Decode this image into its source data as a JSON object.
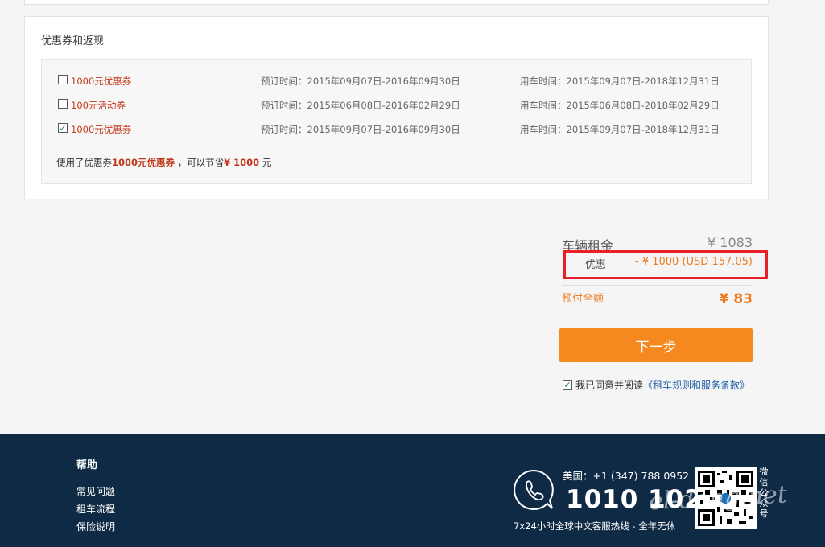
{
  "coupons": {
    "title": "优惠券和返现",
    "items": [
      {
        "name": "1000元优惠券",
        "book_time": "预订时间：2015年09月07日-2016年09月30日",
        "use_time": "用车时间：2015年09月07日-2018年12月31日",
        "checked": false
      },
      {
        "name": "100元活动券",
        "book_time": "预订时间：2015年06月08日-2016年02月29日",
        "use_time": "用车时间：2015年06月08日-2018年02月29日",
        "checked": false
      },
      {
        "name": "1000元优惠券",
        "book_time": "预订时间：2015年09月07日-2016年09月30日",
        "use_time": "用车时间：2015年09月07日-2018年12月31日",
        "checked": true
      }
    ],
    "saving": {
      "prefix": "使用了优惠券",
      "coupon": "1000元优惠券",
      "middle": " ，可以节省",
      "amount": "¥ 1000",
      "suffix": " 元"
    }
  },
  "summary": {
    "rent_label": "车辆租金",
    "rent_value": "¥ 1083",
    "discount_label": "优惠",
    "discount_value": "- ¥ 1000 (USD 157.05)",
    "total_label": "预付全额",
    "total_value": "¥ 83"
  },
  "next_button": "下一步",
  "agreement": {
    "text": "我已同意并阅读",
    "link": "《租车规则和服务条款》",
    "checked": true
  },
  "footer": {
    "help_title": "帮助",
    "help_links": [
      "常见问题",
      "租车流程",
      "保险说明"
    ],
    "hotline_label": "美国：+1 (347) 788 0952",
    "hotline_number": "1010 1020",
    "hotline_desc": "7x24小时全球中文客服热线 - 全年无休",
    "wechat_label": "微信公众号",
    "watermark": "el-dong.net"
  },
  "colors": {
    "accent": "#f5881f",
    "highlight": "#e8202a",
    "footer_bg": "#0f2a45",
    "coupon_red": "#c23a1c"
  }
}
